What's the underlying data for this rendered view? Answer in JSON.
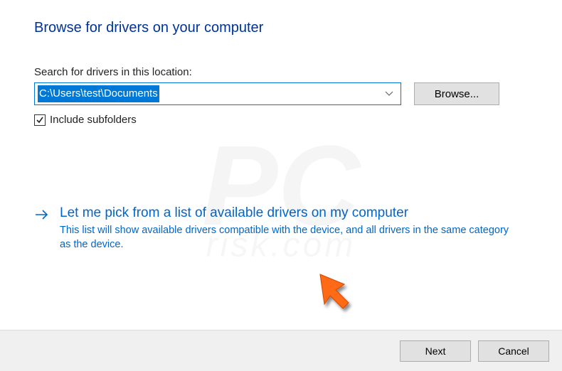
{
  "title": "Browse for drivers on your computer",
  "search_label": "Search for drivers in this location:",
  "path_value": "C:\\Users\\test\\Documents",
  "browse_label": "Browse...",
  "include_subfolders_label": "Include subfolders",
  "include_subfolders_checked": true,
  "pick": {
    "title": "Let me pick from a list of available drivers on my computer",
    "desc": "This list will show available drivers compatible with the device, and all drivers in the same category as the device."
  },
  "footer": {
    "next": "Next",
    "cancel": "Cancel"
  },
  "watermark": {
    "big": "PC",
    "sub": "risk.com"
  }
}
